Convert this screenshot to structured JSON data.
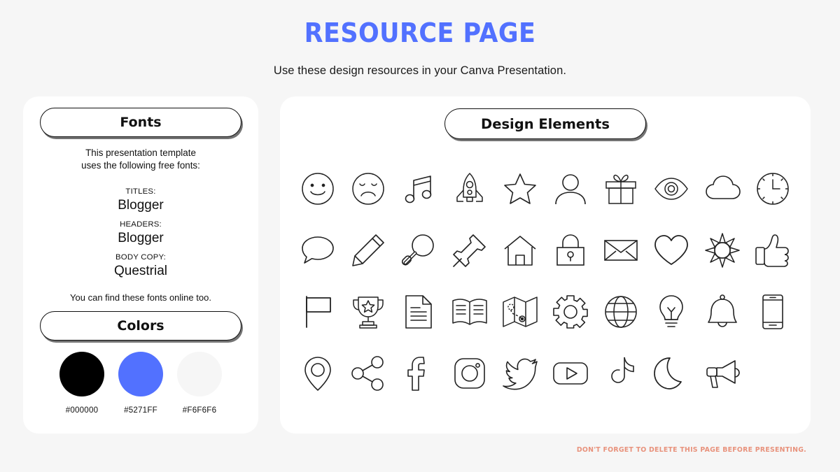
{
  "header": {
    "title": "RESOURCE PAGE",
    "subtitle": "Use these design resources in your Canva Presentation.",
    "title_color": "#5271FF"
  },
  "fonts_panel": {
    "badge_label": "Fonts",
    "intro_line1": "This presentation template",
    "intro_line2": "uses the following free fonts:",
    "entries": [
      {
        "kind": "TITLES:",
        "name": "Blogger"
      },
      {
        "kind": "HEADERS:",
        "name": "Blogger"
      },
      {
        "kind": "BODY COPY:",
        "name": "Questrial"
      }
    ],
    "outro": "You can find these fonts online too."
  },
  "colors_panel": {
    "badge_label": "Colors",
    "swatches": [
      {
        "hex": "#000000"
      },
      {
        "hex": "#5271FF"
      },
      {
        "hex": "#F6F6F6"
      }
    ]
  },
  "design_panel": {
    "badge_label": "Design Elements",
    "icons": [
      "smiley-face-icon",
      "sad-face-icon",
      "music-note-icon",
      "rocket-icon",
      "star-icon",
      "person-icon",
      "gift-icon",
      "eye-icon",
      "cloud-icon",
      "clock-icon",
      "speech-bubble-icon",
      "pencil-icon",
      "magnifying-glass-icon",
      "pushpin-icon",
      "house-icon",
      "padlock-icon",
      "envelope-icon",
      "heart-icon",
      "sun-icon",
      "thumbs-up-icon",
      "flag-icon",
      "trophy-icon",
      "document-icon",
      "open-book-icon",
      "folded-map-icon",
      "gear-icon",
      "globe-icon",
      "lightbulb-icon",
      "bell-icon",
      "smartphone-icon",
      "location-pin-icon",
      "share-icon",
      "facebook-icon",
      "instagram-icon",
      "twitter-icon",
      "youtube-icon",
      "tiktok-icon",
      "moon-icon",
      "megaphone-icon"
    ]
  },
  "footer": {
    "note": "DON'T FORGET TO DELETE THIS PAGE BEFORE PRESENTING.",
    "note_color": "#E8927C"
  }
}
